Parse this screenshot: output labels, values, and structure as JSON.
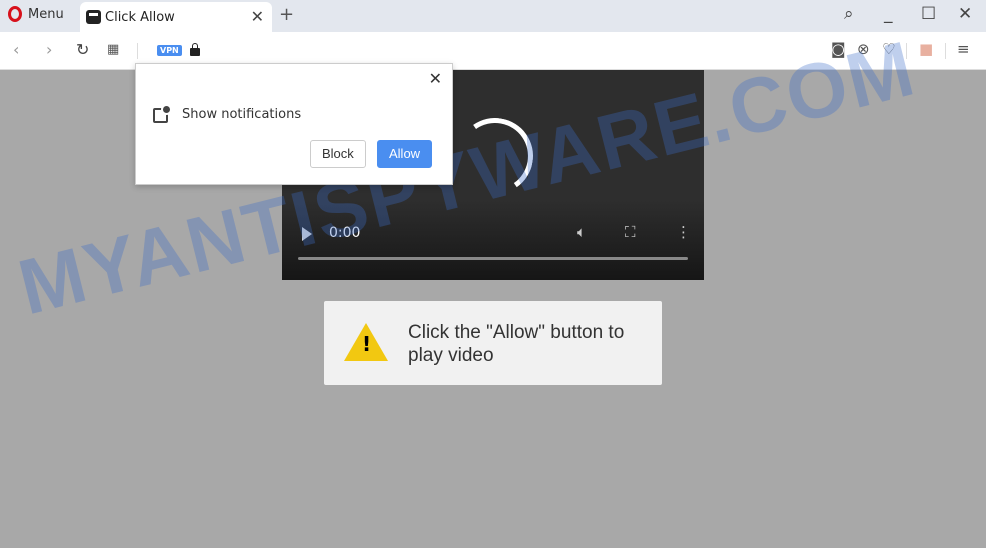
{
  "browser": {
    "menu_label": "Menu",
    "tab_title": "Click Allow",
    "vpn_badge": "VPN"
  },
  "popup": {
    "text": "Show notifications",
    "block_label": "Block",
    "allow_label": "Allow"
  },
  "video": {
    "time": "0:00"
  },
  "message": {
    "text": "Click the \"Allow\" button to play video"
  },
  "watermark": "MYANTISPYWARE.COM",
  "colors": {
    "accent": "#4a8ef0",
    "page_bg": "#a8a8a8",
    "warning": "#f2c811"
  }
}
